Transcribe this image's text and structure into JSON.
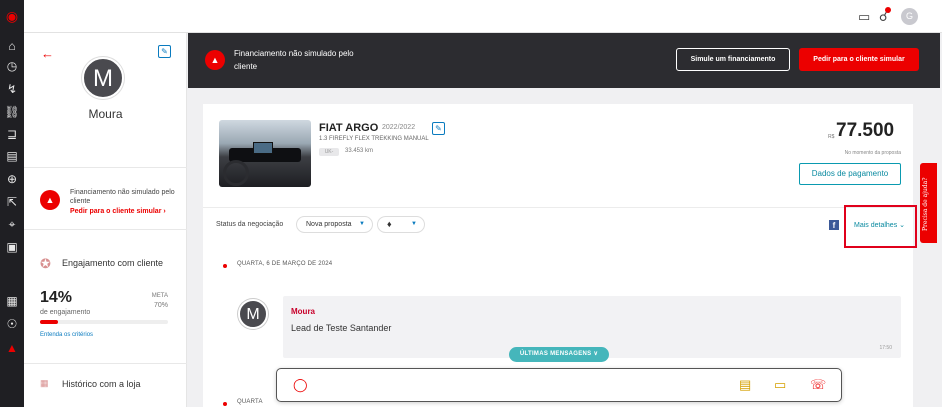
{
  "rail": {
    "icons": [
      "santander-logo-icon",
      "home-icon",
      "clock-icon",
      "lightning-icon",
      "car-plus-icon",
      "cart-icon",
      "calendar-icon",
      "plus-circle-icon",
      "pointer-icon",
      "target-icon",
      "card-icon",
      "id-card-icon",
      "help-circle-icon",
      "mushroom-icon"
    ]
  },
  "topbar": {
    "icons": [
      "chat-icon",
      "bell-icon"
    ],
    "avatar_initial": "G"
  },
  "customer": {
    "initial": "M",
    "name": "Moura",
    "financing_status": "Financiamento não simulado pelo cliente",
    "request_link": "Pedir para o cliente simular",
    "engagement_title": "Engajamento com cliente",
    "engagement_percent": "14%",
    "engagement_label": "de engajamento",
    "engagement_fraction": 0.14,
    "meta_label": "META",
    "meta_value": "70%",
    "criteria_link": "Entenda os critérios",
    "history_title": "Histórico com a loja"
  },
  "banner": {
    "text": "Financiamento não simulado pelo cliente",
    "simulate_button": "Simule um financiamento",
    "request_button": "Pedir para o cliente simular"
  },
  "vehicle": {
    "title": "FIAT ARGO",
    "year": "2022/2022",
    "version": "1.3 FIREFLY FLEX TREKKING MANUAL",
    "km_tag": "UK-",
    "km": "33.453 km",
    "currency": "R$",
    "price": "77.500",
    "price_note": "No momento da proposta",
    "payment_button": "Dados de pagamento"
  },
  "negotiation": {
    "status_label": "Status da negociação",
    "status_value": "Nova proposta",
    "tag_icon": "tag-icon",
    "more_details": "Mais detalhes"
  },
  "timeline": {
    "date1": "QUARTA, 6 DE MARÇO DE 2024",
    "date2": "QUARTA",
    "message": {
      "initial": "M",
      "sender": "Moura",
      "text": "Lead de Teste Santander",
      "time": "17:50"
    },
    "last_messages_button": "ÚLTIMAS MENSAGENS ∨"
  },
  "chatbar": {
    "icons": [
      "chat-search-icon",
      "calendar-clock-icon",
      "message-icon",
      "phone-icon"
    ]
  },
  "help_tab": {
    "label": "Precisa de ajuda?"
  },
  "colors": {
    "brand_red": "#ec0000",
    "dark": "#2c2c30",
    "teal": "#0a8aa0"
  }
}
